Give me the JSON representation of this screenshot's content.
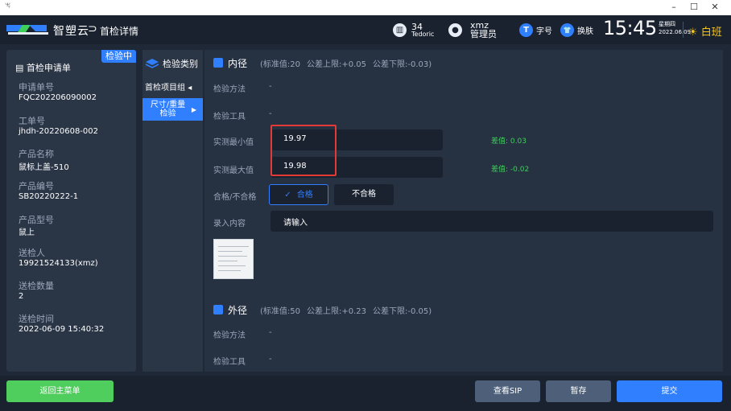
{
  "window": {
    "app_glyph": "ꖕ",
    "minimize": "–",
    "maximize": "☐",
    "close": "✕"
  },
  "header": {
    "logo_text": "智塑云",
    "back_glyph": "⊃",
    "page_title": "首检详情",
    "machine": {
      "icon": "calendar-icon",
      "count": "34",
      "name": "Tedoric"
    },
    "user": {
      "icon": "user-icon",
      "name": "xmz",
      "role": "管理员"
    },
    "font_size_label": "字号",
    "font_size_icon_glyph": "T",
    "theme_label": "换肤",
    "theme_icon_glyph": "👕",
    "time": "15:45",
    "weekday": "星期四",
    "date": "2022.06.09",
    "shift_icon": "☀",
    "shift": "白班"
  },
  "request": {
    "title": "首检申请单",
    "status": "检验中",
    "fields": [
      {
        "label": "申请单号",
        "value": "FQC202206090002"
      },
      {
        "label": "工单号",
        "value": "jhdh-20220608-002"
      },
      {
        "label": "产品名称",
        "value": "鼠标上盖-510"
      },
      {
        "label": "产品编号",
        "value": "SB20220222-1"
      },
      {
        "label": "产品型号",
        "value": "鼠上"
      },
      {
        "label": "送检人",
        "value": "19921524133(xmz)"
      },
      {
        "label": "送检数量",
        "value": "2"
      },
      {
        "label": "送检时间",
        "value": "2022-06-09 15:40:32"
      }
    ]
  },
  "categories": {
    "title": "检验类别",
    "group_label": "首检项目组",
    "group_arrow": "◂",
    "active_line1": "尺寸/重量",
    "active_line2": "检验",
    "active_arrow": "▶"
  },
  "inspection": {
    "item1": {
      "name": "内径",
      "standard": "(标准值:20",
      "upper": "公差上限:+0.05",
      "lower": "公差下限:-0.03)",
      "method_label": "检验方法",
      "method_value": "-",
      "tool_label": "检验工具",
      "tool_value": "-",
      "min_label": "实测最小值",
      "min_value": "19.97",
      "min_diff": "差值: 0.03",
      "max_label": "实测最大值",
      "max_value": "19.98",
      "max_diff": "差值: -0.02",
      "result_label": "合格/不合格",
      "pass_label": "合格",
      "pass_check": "✓",
      "fail_label": "不合格",
      "entry_label": "录入内容",
      "entry_placeholder": "请输入"
    },
    "item2": {
      "name": "外径",
      "standard": "(标准值:50",
      "upper": "公差上限:+0.23",
      "lower": "公差下限:-0.05)",
      "method_label": "检验方法",
      "method_value": "-",
      "tool_label": "检验工具",
      "tool_value": "-"
    }
  },
  "footer": {
    "back": "返回主菜单",
    "view_sip": "查看SIP",
    "save_draft": "暂存",
    "submit": "提交"
  },
  "colors": {
    "accent": "#2f7fff",
    "success": "#4fce5d",
    "diff_text": "#3ecf5b",
    "highlight_frame": "#e53935",
    "shift": "#f5c518"
  }
}
